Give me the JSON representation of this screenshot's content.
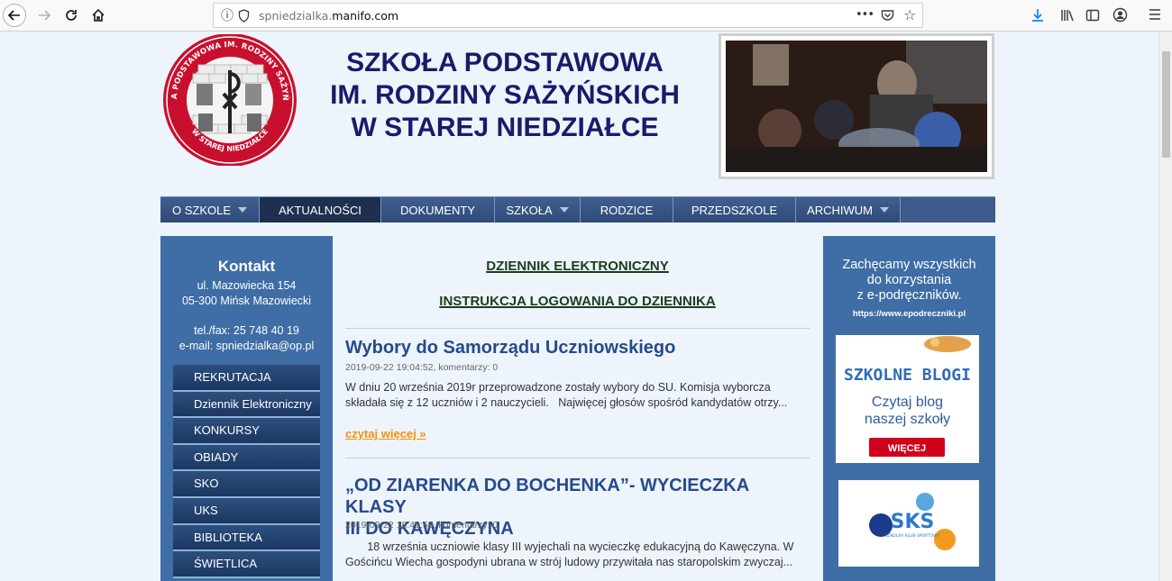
{
  "browser": {
    "url_prefix": "spniedzialka.",
    "url_domain": "manifo.com",
    "menu_dots": "•••"
  },
  "header": {
    "title_line1": "SZKOŁA PODSTAWOWA",
    "title_line2": "IM. RODZINY SAŻYŃSKICH",
    "title_line3": "W STAREJ NIEDZIAŁCE",
    "logo_text_top": "SZKOŁA PODSTAWOWA IM. RODZINY SAŻYŃSKICH",
    "logo_text_bottom": "W STAREJ NIEDZIAŁCE"
  },
  "menu": [
    {
      "label": "O SZKOLE",
      "dropdown": true
    },
    {
      "label": "AKTUALNOŚCI",
      "dropdown": false
    },
    {
      "label": "DOKUMENTY",
      "dropdown": false
    },
    {
      "label": "SZKOŁA",
      "dropdown": true
    },
    {
      "label": "RODZICE",
      "dropdown": false
    },
    {
      "label": "PRZEDSZKOLE",
      "dropdown": false
    },
    {
      "label": "ARCHIWUM",
      "dropdown": true
    }
  ],
  "contact": {
    "heading": "Kontakt",
    "street": "ul. Mazowiecka 154",
    "city": "05-300 Mińsk Mazowiecki",
    "phone": "tel./fax: 25 748 40 19",
    "email": "e-mail: spniedzialka@op.pl"
  },
  "sidemenu": [
    "REKRUTACJA",
    "Dziennik Elektroniczny",
    "KONKURSY",
    "OBIADY",
    "SKO",
    "UKS",
    "BIBLIOTEKA",
    "ŚWIETLICA"
  ],
  "main": {
    "link1": "DZIENNIK ELEKTRONICZNY",
    "link2": "INSTRUKCJA LOGOWANIA DO DZIENNIKA",
    "posts": [
      {
        "title": "Wybory do Samorządu Uczniowskiego",
        "meta": "2019-09-22 19:04:52, komentarzy: 0",
        "body_line1": "W dniu 20 września 2019r przeprowadzone zostały wybory do SU. Komisja wyborcza",
        "body_line2": "składała się z 12 uczniów i 2 nauczycieli.   Najwięcej głosów spośród kandydatów otrzy...",
        "more": "czytaj więcej »"
      },
      {
        "title_line1": "„OD ZIARENKA DO BOCHENKA”- WYCIECZKA KLASY",
        "title_line2": "III DO KAWĘCZYNA",
        "meta": "2019-09-22 18:49:59, komentarzy: 0",
        "body_line1": "       18 września uczniowie klasy III wyjechali na wycieczkę edukacyjną do Kawęczyna. W",
        "body_line2": "Gościńcu Wiecha gospodyni ubrana w strój ludowy przywitała nas staropolskim zwyczaj..."
      }
    ]
  },
  "right": {
    "line1": "Zachęcamy wszystkich",
    "line2": "do korzystania",
    "line3": "z e-podręczników.",
    "url": "https://www.epodreczniki.pl",
    "blog_title": "SZKOLNE BLOGI",
    "blog_line1": "Czytaj blog",
    "blog_line2": "naszej szkoły",
    "blog_button": "WIĘCEJ",
    "sks_label": "SKS",
    "sks_sub": "SZKOLNY KLUB SPORTOWY"
  },
  "colors": {
    "menu_bg": "#3d5a8a",
    "sidebar_bg": "#3f6da5",
    "title_color": "#1a1a6b",
    "post_title": "#264a8c",
    "more_link": "#f0910b"
  }
}
